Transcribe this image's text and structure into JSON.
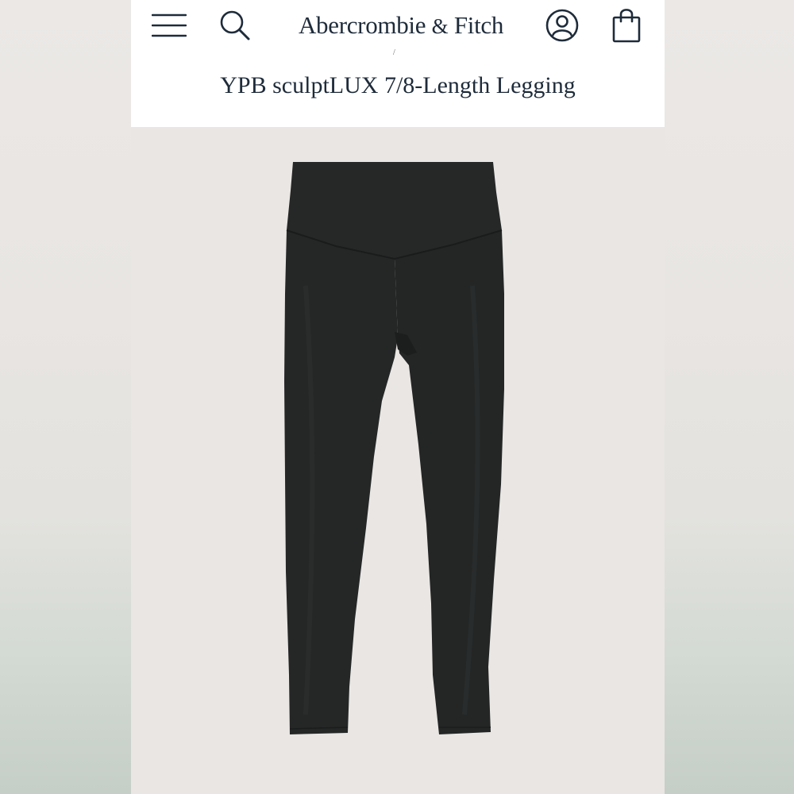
{
  "header": {
    "brand_name": "Abercrombie",
    "brand_amp": "&",
    "brand_suffix": "Fitch",
    "breadcrumb_fragment": "/",
    "icons": {
      "menu": "hamburger-menu-icon",
      "search": "search-icon",
      "account": "account-icon",
      "bag": "shopping-bag-icon"
    }
  },
  "product": {
    "title": "YPB sculptLUX 7/8-Length Legging",
    "image_subject": "black high-waisted leggings"
  },
  "colors": {
    "brand_navy": "#1e2b3a",
    "header_bg": "#ffffff",
    "image_bg": "#e9e6e3",
    "product_color": "#252727"
  }
}
